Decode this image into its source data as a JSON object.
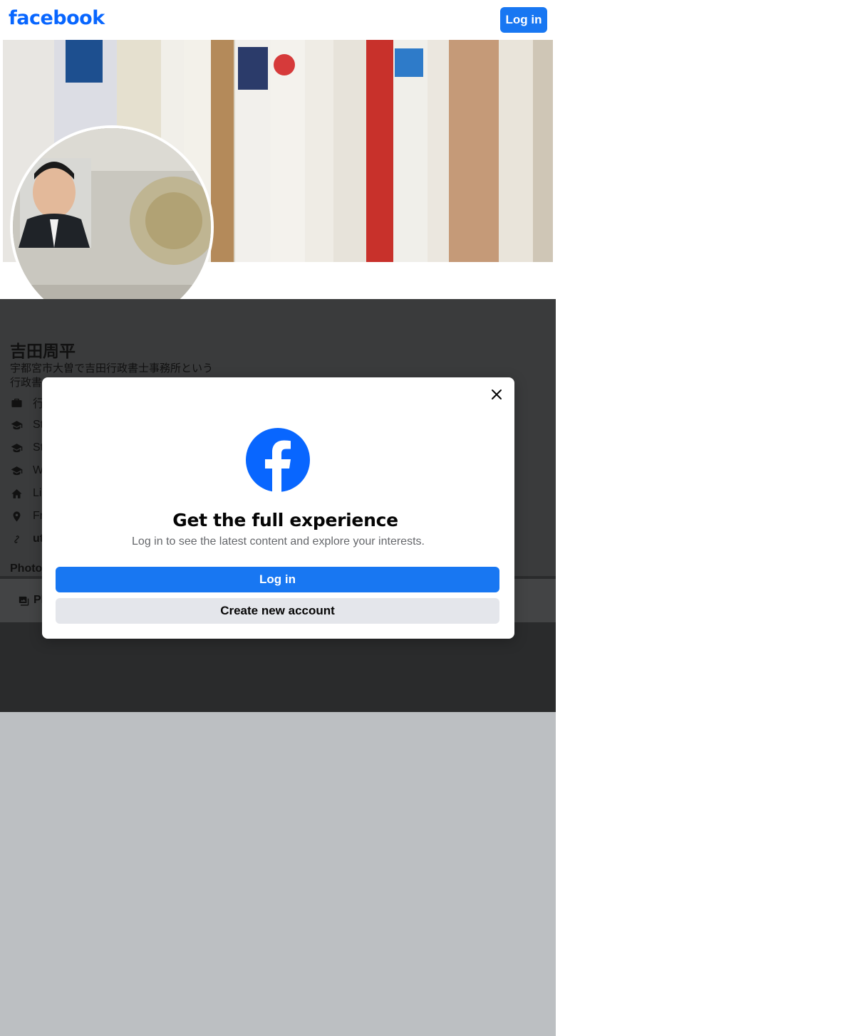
{
  "header": {
    "logo_text": "facebook",
    "login_label": "Log in"
  },
  "profile": {
    "name": "吉田周平",
    "bio_line1": "宇都宮市大曽で吉田行政書士事務所という",
    "bio_line2": "行政書",
    "info_items": [
      {
        "icon": "briefcase-icon",
        "text": "行"
      },
      {
        "icon": "graduation-cap-icon",
        "text": "St"
      },
      {
        "icon": "graduation-cap-icon",
        "text": "St"
      },
      {
        "icon": "graduation-cap-icon",
        "text": "W"
      },
      {
        "icon": "home-icon",
        "text": "Li"
      },
      {
        "icon": "location-pin-icon",
        "text": "Fr"
      },
      {
        "icon": "link-icon",
        "text": "ut"
      }
    ],
    "photos_label": "Photo",
    "tab_label": "Pl"
  },
  "modal": {
    "title": "Get the full experience",
    "subtitle": "Log in to see the latest content and explore your interests.",
    "login_label": "Log in",
    "create_label": "Create new account"
  },
  "colors": {
    "brand": "#0866ff",
    "button": "#1877f2",
    "overlay": "#3a3b3c"
  }
}
